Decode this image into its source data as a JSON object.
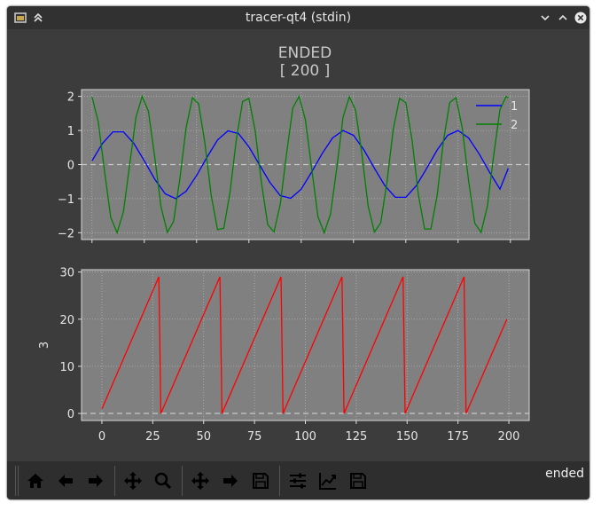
{
  "window": {
    "title": "tracer-qt4 (stdin)"
  },
  "figure": {
    "title_line1": "ENDED",
    "title_line2": "[ 200 ]"
  },
  "status_text": "ended",
  "colors": {
    "bg": "#3c3c3c",
    "axes_bg": "#808080",
    "series1": "#0000ff",
    "series2": "#008000",
    "series3": "#ff0000",
    "text": "#e6e6e6"
  },
  "icons": [
    "home-icon",
    "back-arrow-icon",
    "forward-arrow-icon",
    "pan-icon",
    "zoom-icon",
    "pan-icon",
    "forward-arrow-icon",
    "save-icon",
    "sliders-icon",
    "line-chart-icon",
    "save-icon"
  ],
  "chart_data": [
    {
      "type": "line",
      "xlim": [
        -5,
        209
      ],
      "ylim": [
        -2.2,
        2.2
      ],
      "yticks": [
        -2,
        -1,
        0,
        1,
        2
      ],
      "ytick_labels": [
        "−2",
        "−1",
        "0",
        "1",
        "2"
      ],
      "grid": true,
      "legend": "top-right",
      "series": [
        {
          "name": "1",
          "color": "#0000ff",
          "x": [
            0,
            5,
            10,
            15,
            20,
            25,
            30,
            35,
            40,
            45,
            50,
            55,
            60,
            65,
            70,
            75,
            80,
            85,
            90,
            95,
            100,
            105,
            110,
            115,
            120,
            125,
            130,
            135,
            140,
            145,
            150,
            155,
            160,
            165,
            170,
            175,
            180,
            185,
            190,
            195,
            199
          ],
          "y": [
            0.11,
            0.62,
            0.96,
            0.96,
            0.62,
            0.11,
            -0.43,
            -0.86,
            -1.0,
            -0.78,
            -0.32,
            0.22,
            0.72,
            0.99,
            0.91,
            0.52,
            0.0,
            -0.52,
            -0.91,
            -0.99,
            -0.72,
            -0.22,
            0.32,
            0.78,
            1.0,
            0.86,
            0.43,
            -0.11,
            -0.62,
            -0.96,
            -0.96,
            -0.62,
            -0.11,
            0.43,
            0.86,
            1.0,
            0.78,
            0.32,
            -0.22,
            -0.72,
            -0.11
          ]
        },
        {
          "name": "2",
          "color": "#008000",
          "x": [
            0,
            3,
            6,
            9,
            12,
            15,
            18,
            21,
            24,
            27,
            30,
            33,
            36,
            39,
            42,
            45,
            48,
            51,
            54,
            57,
            60,
            63,
            66,
            69,
            72,
            75,
            78,
            81,
            84,
            87,
            90,
            93,
            96,
            99,
            102,
            105,
            108,
            111,
            114,
            117,
            120,
            123,
            126,
            129,
            132,
            135,
            138,
            141,
            144,
            147,
            150,
            153,
            156,
            159,
            162,
            165,
            168,
            171,
            174,
            177,
            180,
            183,
            186,
            189,
            192,
            195,
            198,
            199
          ],
          "y": [
            1.99,
            1.25,
            -0.21,
            -1.56,
            -2.0,
            -1.39,
            0.0,
            1.39,
            2.0,
            1.56,
            0.21,
            -1.25,
            -1.99,
            -1.67,
            -0.42,
            1.09,
            1.96,
            1.78,
            0.62,
            -0.91,
            -1.91,
            -1.87,
            -0.81,
            0.73,
            1.85,
            1.94,
            0.99,
            -0.52,
            -1.76,
            -1.98,
            -1.16,
            0.32,
            1.66,
            2.0,
            1.32,
            -0.11,
            -1.53,
            -2.0,
            -1.46,
            -0.11,
            1.39,
            1.99,
            1.6,
            0.32,
            -1.22,
            -1.98,
            -1.71,
            -0.52,
            1.03,
            1.94,
            1.82,
            0.71,
            -0.87,
            -1.89,
            -1.89,
            -0.9,
            0.68,
            1.82,
            1.96,
            1.07,
            -0.47,
            -1.72,
            -1.99,
            -1.23,
            0.26,
            1.61,
            2.0,
            1.96
          ]
        }
      ]
    },
    {
      "type": "line",
      "xlim": [
        -10,
        210
      ],
      "ylim": [
        -1.5,
        30.5
      ],
      "xticks": [
        0,
        25,
        50,
        75,
        100,
        125,
        150,
        175,
        200
      ],
      "yticks": [
        0,
        10,
        20,
        30
      ],
      "ylabel": "3",
      "grid": true,
      "series": [
        {
          "color": "#ff0000",
          "x": [
            0,
            28,
            29,
            58,
            59,
            88,
            89,
            118,
            119,
            148,
            149,
            178,
            179,
            199
          ],
          "y": [
            1,
            29,
            0,
            29,
            0,
            29,
            0,
            29,
            0,
            29,
            0,
            29,
            0,
            20
          ]
        }
      ]
    }
  ]
}
